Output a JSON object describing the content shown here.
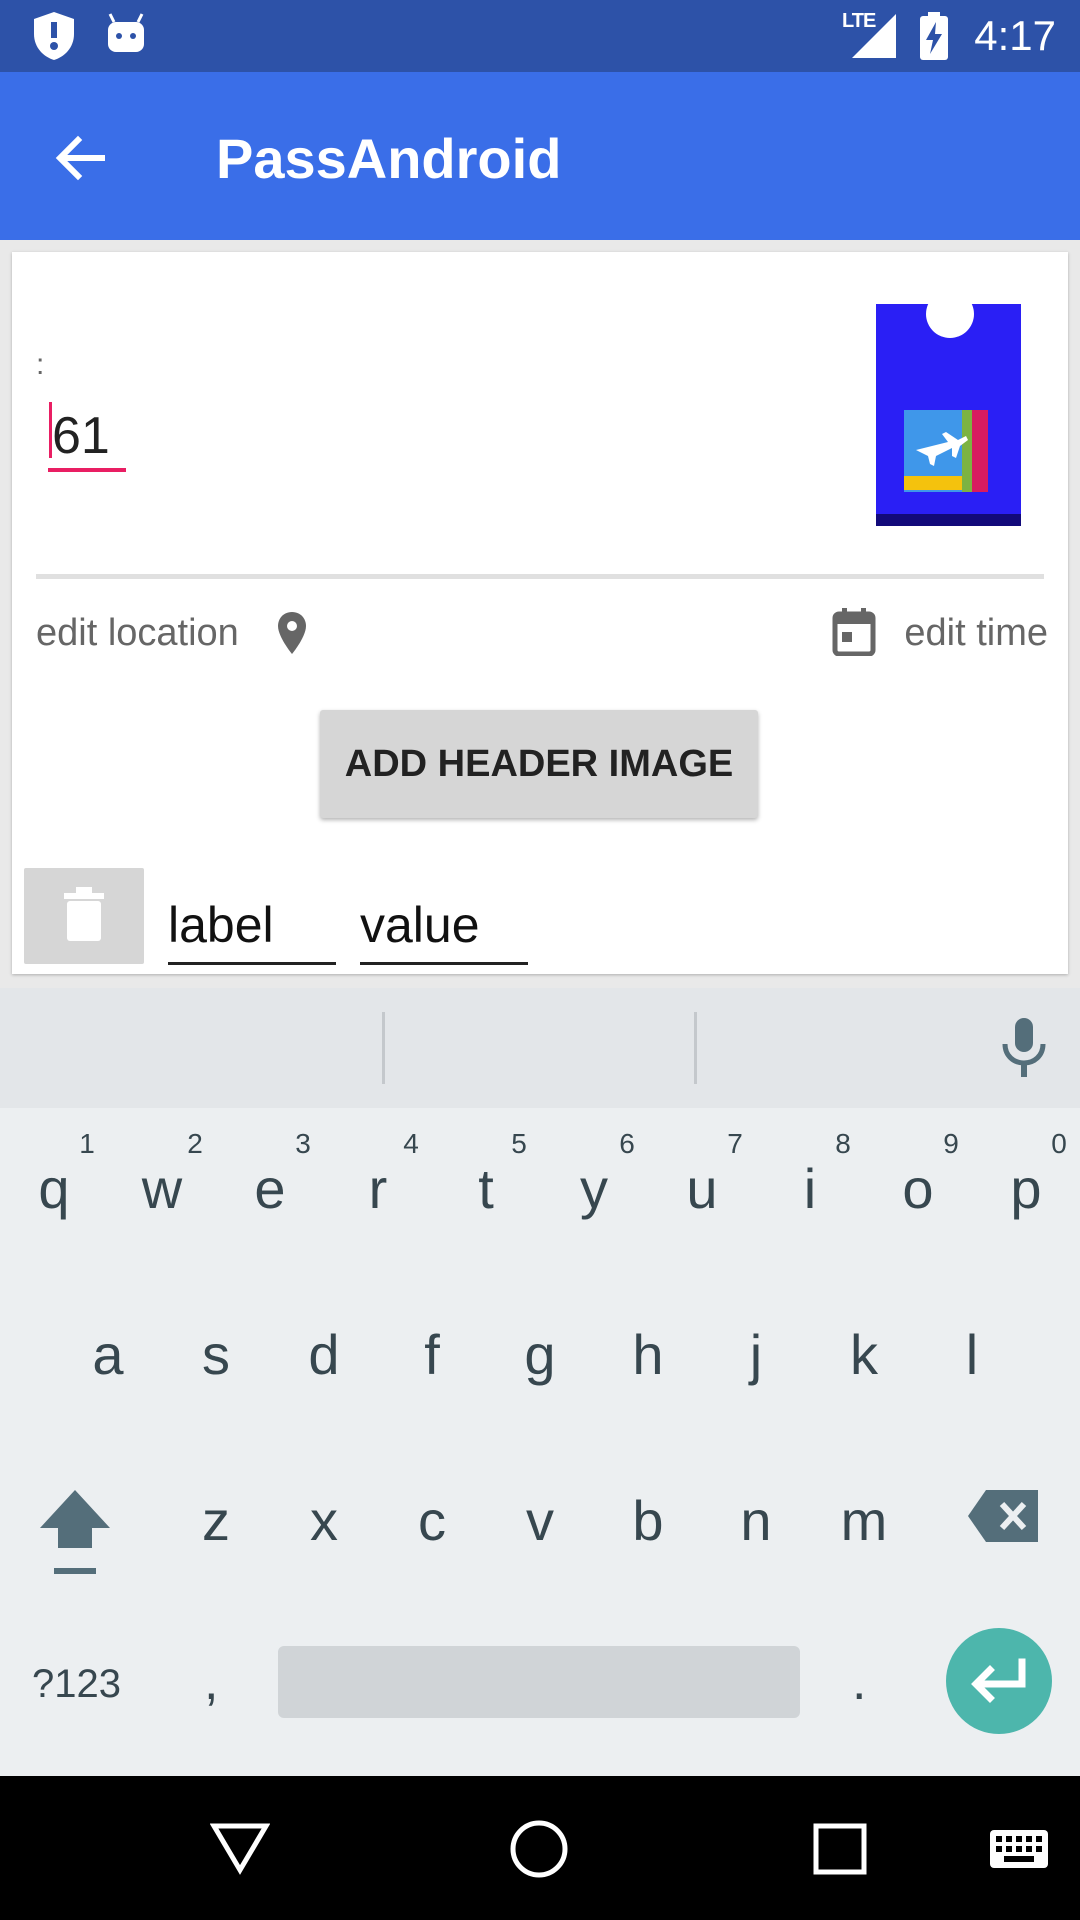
{
  "status_bar": {
    "time": "4:17",
    "network": "LTE"
  },
  "app_bar": {
    "title": "PassAndroid"
  },
  "card": {
    "field_label": ":",
    "field_value": "61",
    "edit_location": "edit location",
    "edit_time": "edit time",
    "add_header_button": "ADD HEADER IMAGE",
    "label_field": "label",
    "value_field": "value"
  },
  "keyboard": {
    "row1": [
      "q",
      "w",
      "e",
      "r",
      "t",
      "y",
      "u",
      "i",
      "o",
      "p"
    ],
    "row1_hints": [
      "1",
      "2",
      "3",
      "4",
      "5",
      "6",
      "7",
      "8",
      "9",
      "0"
    ],
    "row2": [
      "a",
      "s",
      "d",
      "f",
      "g",
      "h",
      "j",
      "k",
      "l"
    ],
    "row3": [
      "z",
      "x",
      "c",
      "v",
      "b",
      "n",
      "m"
    ],
    "symbols_key": "?123",
    "comma_key": ",",
    "period_key": "."
  },
  "colors": {
    "status_bar": "#2d52a8",
    "app_bar": "#3a6ee8",
    "accent": "#e91e63",
    "enter_key": "#4db6ac",
    "pass_thumbnail": "#2a1ff5"
  },
  "icons": [
    "shield-icon",
    "android-debug-icon",
    "signal-icon",
    "battery-charging-icon",
    "back-arrow-icon",
    "location-pin-icon",
    "calendar-icon",
    "trash-icon",
    "mic-icon",
    "shift-icon",
    "backspace-icon",
    "enter-icon",
    "nav-back-icon",
    "nav-home-icon",
    "nav-recents-icon",
    "keyboard-switch-icon"
  ]
}
